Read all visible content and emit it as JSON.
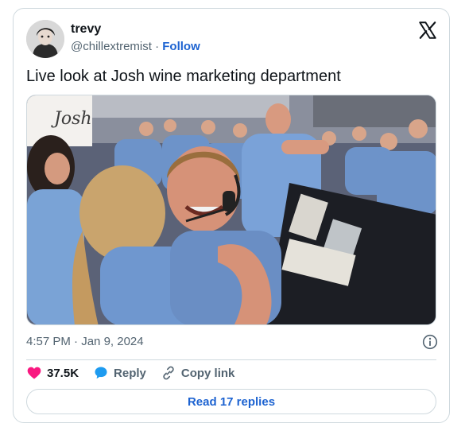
{
  "author": {
    "display_name": "trevy",
    "handle": "@chillextremist",
    "separator": "·",
    "follow_label": "Follow"
  },
  "tweet": {
    "text": "Live look at Josh wine marketing department",
    "time": "4:57 PM",
    "date_separator": "·",
    "date": "Jan 9, 2024"
  },
  "photo": {
    "sign_text": "Josh"
  },
  "actions": {
    "likes_count": "37.5K",
    "reply_label": "Reply",
    "copy_link_label": "Copy link"
  },
  "read_replies_label": "Read 17 replies",
  "icons": {
    "brand": "x-logo-icon",
    "like": "heart-icon",
    "reply": "speech-bubble-icon",
    "link": "link-icon",
    "info": "info-icon"
  },
  "colors": {
    "like": "#f91880",
    "reply": "#1d9bf0",
    "link_text": "#1d63d1",
    "muted": "#536471",
    "border": "#cfd9de"
  }
}
